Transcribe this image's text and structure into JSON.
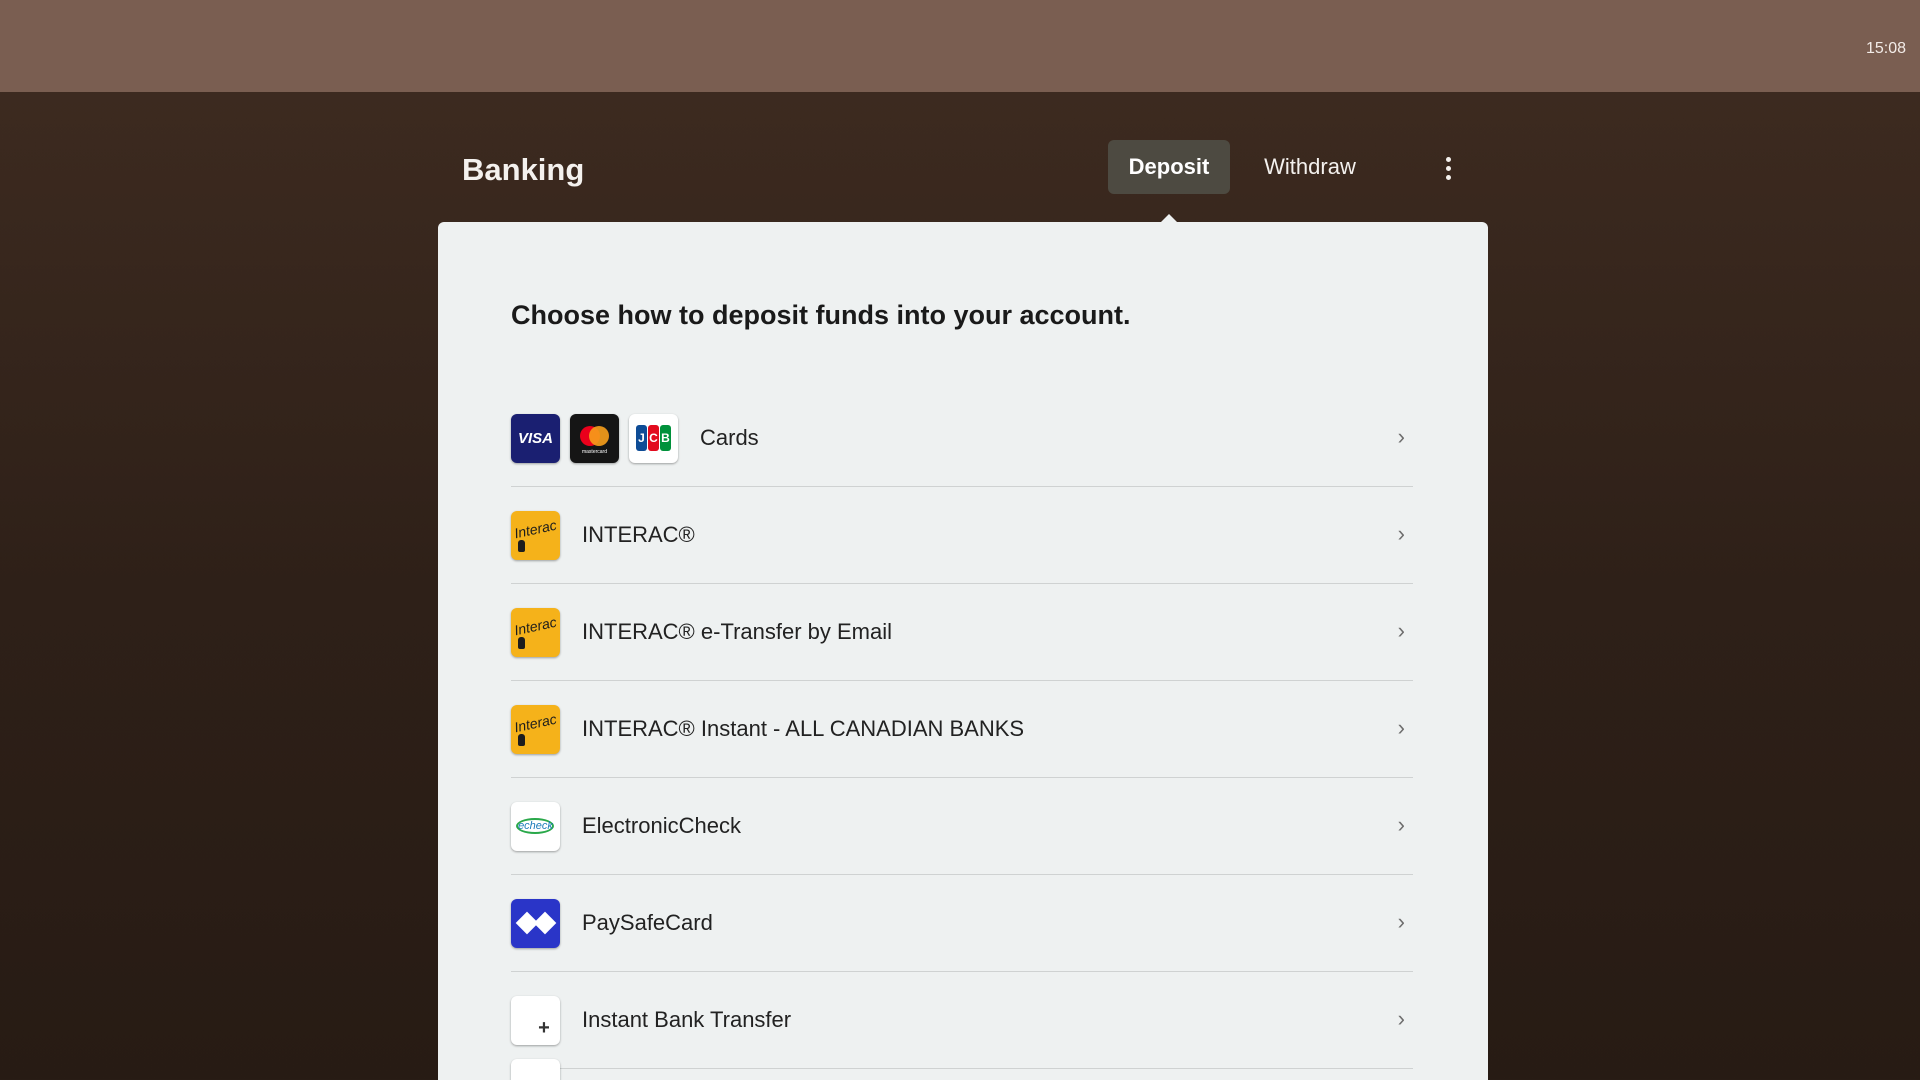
{
  "status_bar": {
    "time": "15:08"
  },
  "header": {
    "title": "Banking",
    "tabs": [
      {
        "label": "Deposit",
        "active": true
      },
      {
        "label": "Withdraw",
        "active": false
      }
    ],
    "menu_icon": "vertical-dots-icon"
  },
  "panel": {
    "heading": "Choose how to deposit funds into your account.",
    "methods": [
      {
        "label": "Cards",
        "logos": [
          "visa-logo",
          "mastercard-logo",
          "jcb-logo"
        ]
      },
      {
        "label": "INTERAC®",
        "logos": [
          "interac-logo"
        ]
      },
      {
        "label": "INTERAC® e-Transfer by Email",
        "logos": [
          "interac-logo"
        ]
      },
      {
        "label": "INTERAC® Instant - ALL CANADIAN BANKS",
        "logos": [
          "interac-logo"
        ]
      },
      {
        "label": "ElectronicCheck",
        "logos": [
          "echeck-logo"
        ]
      },
      {
        "label": "PaySafeCard",
        "logos": [
          "paysafecard-logo"
        ]
      },
      {
        "label": "Instant Bank Transfer",
        "logos": [
          "instant-bank-transfer-logo"
        ]
      }
    ]
  },
  "logo_text": {
    "visa": "VISA",
    "mastercard": "mastercard",
    "jcb": [
      "J",
      "C",
      "B"
    ],
    "interac": "Interac",
    "echeck": "echeck"
  },
  "colors": {
    "topbar": "#7a5e51",
    "background": "#3a281e",
    "panel": "#eef1f1",
    "active_tab": "#4d4a41",
    "chevron": "#6e6e6e"
  }
}
